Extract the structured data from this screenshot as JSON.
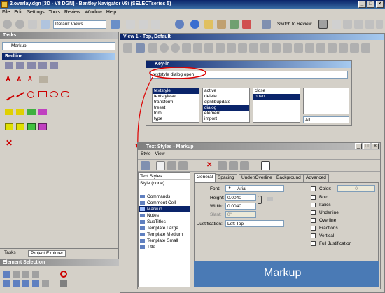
{
  "window": {
    "title": "2.overlay.dgn [3D - V8 DGN] - Bentley Navigator V8i (SELECTseries 5)"
  },
  "menu": [
    "File",
    "Edit",
    "Settings",
    "Tools",
    "Review",
    "Window",
    "Help"
  ],
  "toolbar": {
    "views_select": "Default Views",
    "switch_review": "Switch to Review"
  },
  "tasks": {
    "title": "Tasks",
    "markup_select": "Markup",
    "redline_title": "Redline",
    "bottom_tabs": [
      "Tasks",
      "Project Explorer"
    ]
  },
  "element_selection": {
    "title": "Element Selection"
  },
  "view": {
    "title": "View 1 - Top, Default"
  },
  "keyin": {
    "title": "Key-in",
    "input_value": "textstyle dialog open",
    "col1": [
      "textstyle",
      "textstyleset",
      "transform",
      "treset",
      "trim",
      "type"
    ],
    "col2": [
      "active",
      "delete",
      "dgnlibupdate",
      "dialog",
      "element",
      "import"
    ],
    "col3": [
      "close",
      "open"
    ],
    "filter": "All"
  },
  "text_styles": {
    "title": "Text Styles - Markup",
    "menu": [
      "Style",
      "View"
    ],
    "list_header": "Text Styles",
    "style_none": "Style (none)",
    "styles": [
      "Commands",
      "Comment Cell",
      "Markup",
      "Notes",
      "SubTitles",
      "Template Large",
      "Template Medium",
      "Template Small",
      "Title"
    ],
    "selected_style": "Markup",
    "tabs": [
      "General",
      "Spacing",
      "Under/Overline",
      "Background",
      "Advanced"
    ],
    "font_label": "Font:",
    "font_value": "Arial",
    "height_label": "Height:",
    "height_value": "0.0040",
    "width_label": "Width:",
    "width_value": "0.0040",
    "slant_label": "Slant:",
    "slant_value": "0°",
    "justification_label": "Justification:",
    "justification_value": "Left Top",
    "color_label": "Color:",
    "color_value": "0",
    "checks": [
      "Bold",
      "Italics",
      "Underline",
      "Overline",
      "Fractions",
      "Vertical",
      "Full Justification"
    ],
    "preview_text": "Markup"
  }
}
